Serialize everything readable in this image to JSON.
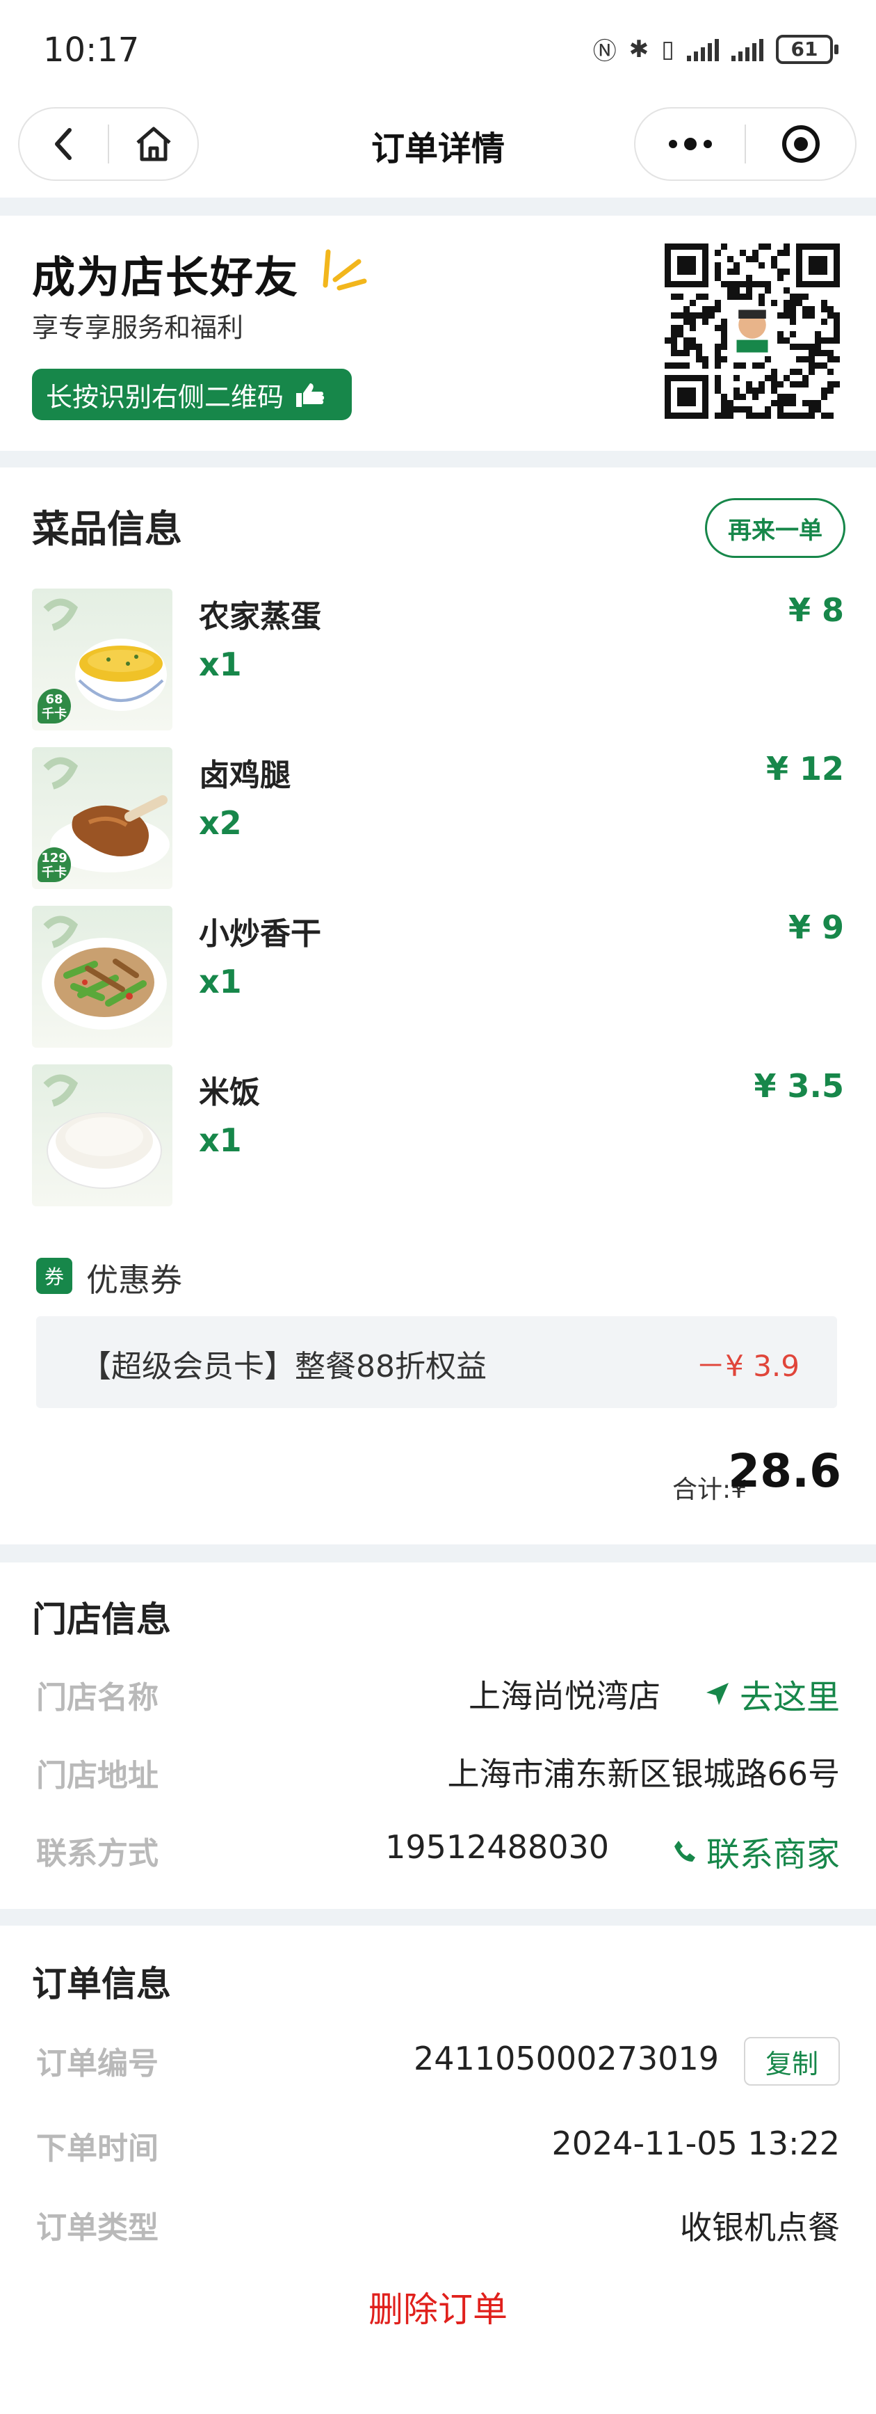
{
  "status_bar": {
    "time": "10:17",
    "battery": "61"
  },
  "nav": {
    "title": "订单详情"
  },
  "promo": {
    "title": "成为店长好友",
    "subtitle": "享专享服务和福利",
    "button": "长按识别右侧二维码"
  },
  "dishes": {
    "title": "菜品信息",
    "reorder": "再来一单",
    "items": [
      {
        "name": "农家蒸蛋",
        "qty": "x1",
        "price": "¥ 8",
        "kcal": "68",
        "unit": "千卡"
      },
      {
        "name": "卤鸡腿",
        "qty": "x2",
        "price": "¥ 12",
        "kcal": "129",
        "unit": "千卡"
      },
      {
        "name": "小炒香干",
        "qty": "x1",
        "price": "¥ 9"
      },
      {
        "name": "米饭",
        "qty": "x1",
        "price": "¥ 3.5"
      }
    ]
  },
  "coupon": {
    "badge": "券",
    "label": "优惠券",
    "name": "【超级会员卡】整餐88折权益",
    "discount": "－¥ 3.9"
  },
  "total": {
    "label": "合计:",
    "currency": "¥",
    "value": "28.6"
  },
  "store": {
    "title": "门店信息",
    "name_label": "门店名称",
    "name": "上海尚悦湾店",
    "navigate": "去这里",
    "address_label": "门店地址",
    "address": "上海市浦东新区银城路66号",
    "contact_label": "联系方式",
    "phone": "19512488030",
    "call": "联系商家"
  },
  "order": {
    "title": "订单信息",
    "number_label": "订单编号",
    "number": "241105000273019",
    "copy": "复制",
    "time_label": "下单时间",
    "time": "2024-11-05 13:22",
    "type_label": "订单类型",
    "type": "收银机点餐",
    "delete": "删除订单"
  },
  "colors": {
    "accent": "#17874a",
    "discount": "#e0453a",
    "danger": "#e0201c",
    "separator": "#eef2f5"
  }
}
